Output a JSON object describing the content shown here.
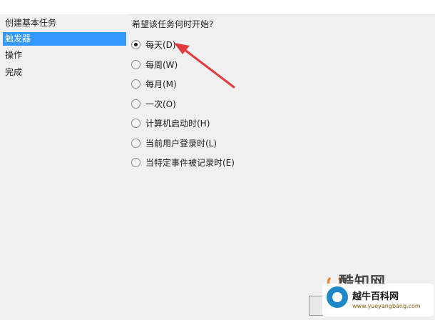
{
  "sidebar": {
    "steps": [
      {
        "label": "创建基本任务"
      },
      {
        "label": "触发器"
      },
      {
        "label": "操作"
      },
      {
        "label": "完成"
      }
    ]
  },
  "main": {
    "question": "希望该任务何时开始?",
    "options": [
      {
        "label": "每天(D)",
        "checked": true
      },
      {
        "label": "每周(W)",
        "checked": false
      },
      {
        "label": "每月(M)",
        "checked": false
      },
      {
        "label": "一次(O)",
        "checked": false
      },
      {
        "label": "计算机启动时(H)",
        "checked": false
      },
      {
        "label": "当前用户登录时(L)",
        "checked": false
      },
      {
        "label": "当特定事件被记录时(E)",
        "checked": false
      }
    ]
  },
  "watermark": {
    "brand": "酷知网",
    "badge_title": "越牛百科网",
    "badge_url": "www.yueyangbang.com"
  },
  "colors": {
    "selection": "#3399ff",
    "arrow": "#e23b3b",
    "background": "#f0f0f0"
  }
}
